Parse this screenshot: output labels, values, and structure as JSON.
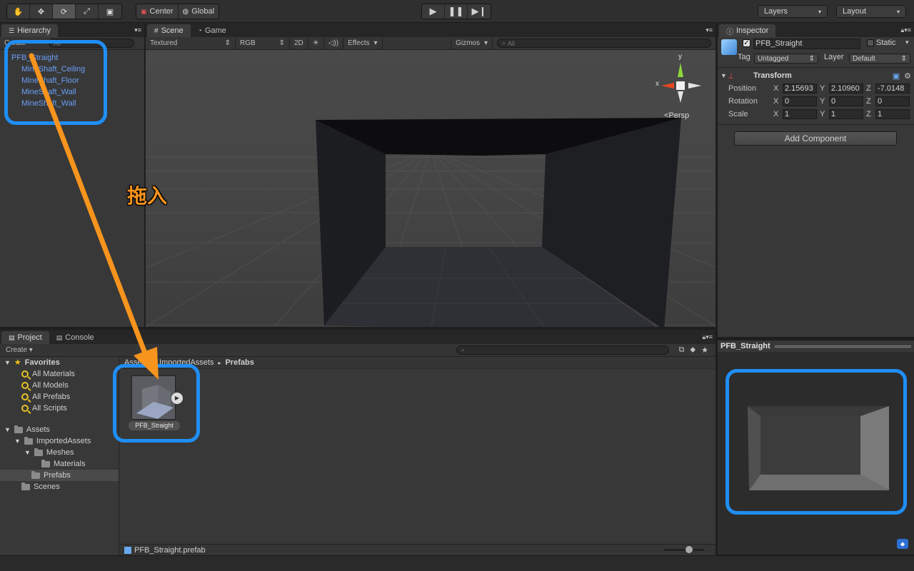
{
  "toolbar": {
    "tools": [
      {
        "name": "hand-tool-button",
        "icon": "hand-icon",
        "glyph": "✋"
      },
      {
        "name": "move-tool-button",
        "icon": "move-arrows-icon",
        "glyph": "✥"
      },
      {
        "name": "rotate-tool-button",
        "icon": "rotate-icon",
        "glyph": "⟳"
      },
      {
        "name": "scale-tool-button",
        "icon": "scale-icon",
        "glyph": "⤢"
      },
      {
        "name": "rect-tool-button",
        "icon": "rect-icon",
        "glyph": "▣"
      }
    ],
    "pivot_label": "Center",
    "space_label": "Global",
    "layers_label": "Layers",
    "layout_label": "Layout"
  },
  "hierarchy": {
    "tab_label": "Hierarchy",
    "create_label": "Create",
    "search_placeholder": "All",
    "items": [
      {
        "label": "PFB_Straight"
      },
      {
        "label": "MineShaft_Ceiling"
      },
      {
        "label": "MineShaft_Floor"
      },
      {
        "label": "MineShaft_Wall"
      },
      {
        "label": "MineShaft_Wall"
      }
    ]
  },
  "scene": {
    "tab_label": "Scene",
    "game_tab_label": "Game",
    "shading": "Textured",
    "render_mode": "RGB",
    "mode_2d": "2D",
    "effects": "Effects",
    "gizmos": "Gizmos",
    "search_placeholder": "All",
    "persp_label": "Persp",
    "axis_y": "y",
    "axis_x": "x"
  },
  "annotation": {
    "drag_label": "拖入"
  },
  "inspector": {
    "tab_label": "Inspector",
    "object_name": "PFB_Straight",
    "static_label": "Static",
    "tag_label": "Tag",
    "tag_value": "Untagged",
    "layer_label": "Layer",
    "layer_value": "Default",
    "component": "Transform",
    "position_label": "Position",
    "rotation_label": "Rotation",
    "scale_label": "Scale",
    "position": {
      "x": "2.15693",
      "y": "2.10960",
      "z": "-7.0148"
    },
    "rotation": {
      "x": "0",
      "y": "0",
      "z": "0"
    },
    "scale": {
      "x": "1",
      "y": "1",
      "z": "1"
    },
    "add_component_label": "Add Component",
    "preview_title": "PFB_Straight"
  },
  "project": {
    "tab_label": "Project",
    "console_tab_label": "Console",
    "create_label": "Create",
    "favorites_label": "Favorites",
    "favorites": [
      "All Materials",
      "All Models",
      "All Prefabs",
      "All Scripts"
    ],
    "assets_label": "Assets",
    "folders": [
      "ImportedAssets",
      "Meshes",
      "Materials",
      "Prefabs",
      "Scenes"
    ],
    "breadcrumb": [
      "Assets",
      "ImportedAssets",
      "Prefabs"
    ],
    "asset_name": "PFB_Straight",
    "status_file": "PFB_Straight.prefab"
  },
  "colors": {
    "highlight": "#1f8ef5",
    "arrow": "#f7941d",
    "hierarchy_text": "#6a9ff7"
  }
}
